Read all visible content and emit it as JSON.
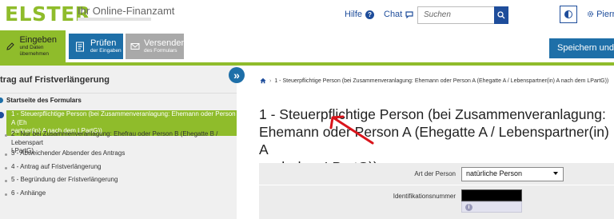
{
  "header": {
    "logo": "ELSTER",
    "logo_subtitle": "Ihr Online-Finanzamt",
    "help_label": "Hilfe",
    "chat_label": "Chat",
    "search_placeholder": "Suchen",
    "user_label": "Pierre"
  },
  "toolbar": {
    "eingeben_title": "Eingeben",
    "eingeben_sub": "und Daten übernehmen",
    "pruefen_title": "Prüfen",
    "pruefen_sub": "der Eingaben",
    "versenden_title": "Versenden",
    "versenden_sub": "des Formulars",
    "save_label": "Speichern und For"
  },
  "sidebar": {
    "title": "trag auf Fristverlängerung",
    "start_label": "Startseite des Formulars",
    "items": [
      {
        "label_line1": "1 - Steuerpflichtige Person (bei Zusammenveranlagung: Ehemann oder Person A (Eh",
        "label_line2": "partner(in) A nach dem LPartG))"
      },
      {
        "label_line1": "2 - Nur bei Zusammenveranlagung: Ehefrau oder Person B (Ehegatte B / Lebenspart",
        "label_line2": "LPartG)"
      },
      {
        "label_line1": "3 - Abweichender Absender des Antrags"
      },
      {
        "label_line1": "4 - Antrag auf Fristverlängerung"
      },
      {
        "label_line1": "5 - Begründung der Fristverlängerung"
      },
      {
        "label_line1": "6 - Anhänge"
      }
    ]
  },
  "main": {
    "breadcrumb": "1 - Steuerpflichtige Person (bei Zusammenveranlagung: Ehemann oder Person A (Ehegatte A / Lebenspartner(in) A nach dem LPartG))",
    "heading_line1": "1 - Steuerpflichtige Person (bei Zusammenveranlagung:",
    "heading_line2": "Ehemann oder Person A (Ehegatte A / Lebenspartner(in) A",
    "heading_line3": "nach dem LPartG))",
    "art_label": "Art der Person",
    "art_value": "natürliche Person",
    "id_label": "Identifikationsnummer"
  },
  "colors": {
    "elster_green": "#8fbc2b",
    "elster_blue": "#1e6fa8",
    "link_blue": "#1e4d9b",
    "annotation_red": "#d9141b"
  }
}
